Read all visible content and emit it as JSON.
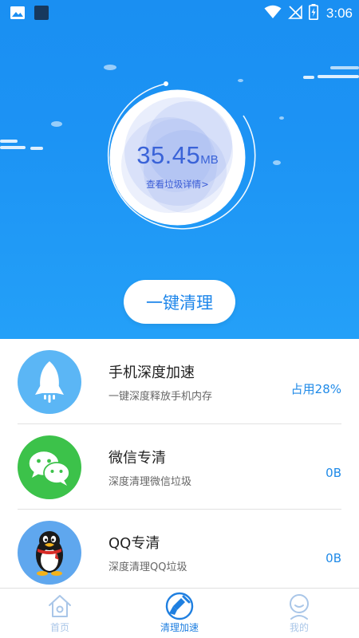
{
  "status_bar": {
    "time": "3:06",
    "icons": [
      "image-icon",
      "app-square-icon",
      "wifi-icon",
      "no-signal-icon",
      "battery-charging-icon"
    ]
  },
  "gauge": {
    "value": "35.45",
    "unit": "MB",
    "link_text": "查看垃圾详情>"
  },
  "clean_button": {
    "label": "一键清理"
  },
  "features": [
    {
      "title": "手机深度加速",
      "subtitle": "一键深度释放手机内存",
      "value": "占用28%",
      "icon": "rocket-icon",
      "icon_bg": "#5bb6f5"
    },
    {
      "title": "微信专清",
      "subtitle": "深度清理微信垃圾",
      "value": "0B",
      "icon": "wechat-icon",
      "icon_bg": "#3cc24a"
    },
    {
      "title": "QQ专清",
      "subtitle": "深度清理QQ垃圾",
      "value": "0B",
      "icon": "qq-penguin-icon",
      "icon_bg": "#5fa7ee"
    }
  ],
  "bottom_nav": {
    "items": [
      {
        "label": "首页",
        "icon": "home-icon",
        "active": false
      },
      {
        "label": "清理加速",
        "icon": "broom-icon",
        "active": true
      },
      {
        "label": "我的",
        "icon": "profile-icon",
        "active": false
      }
    ]
  },
  "colors": {
    "brand_blue": "#1c8ff2",
    "accent_text": "#1f8ae8",
    "gauge_text": "#3a63d8"
  }
}
